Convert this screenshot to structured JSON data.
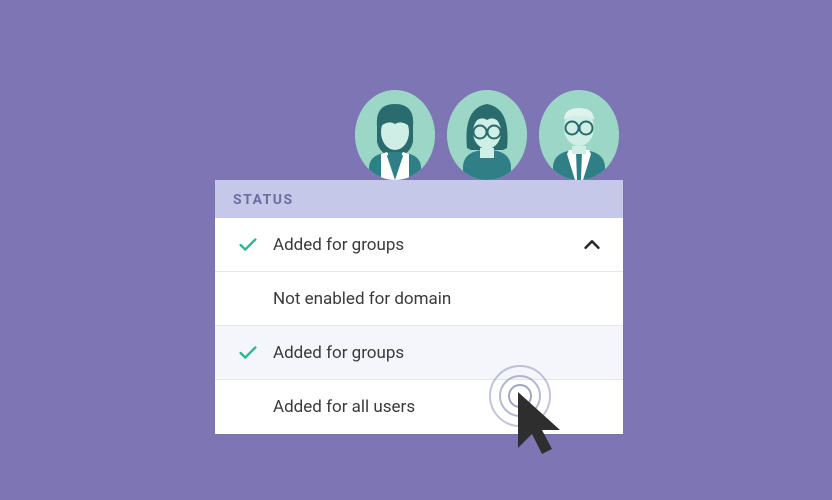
{
  "panel": {
    "header": "STATUS",
    "selected": {
      "label": "Added for groups",
      "checked": true
    },
    "options": [
      {
        "label": "Not enabled for domain",
        "checked": false,
        "highlight": false
      },
      {
        "label": "Added for groups",
        "checked": true,
        "highlight": true
      },
      {
        "label": "Added for all users",
        "checked": false,
        "highlight": false
      }
    ]
  },
  "colors": {
    "accent_check": "#2bb795",
    "header_bg": "#c5c8e8",
    "header_text": "#6a6fa0",
    "page_bg": "#7e76b4"
  },
  "avatars": [
    "user-avatar-1",
    "user-avatar-2",
    "user-avatar-3"
  ]
}
